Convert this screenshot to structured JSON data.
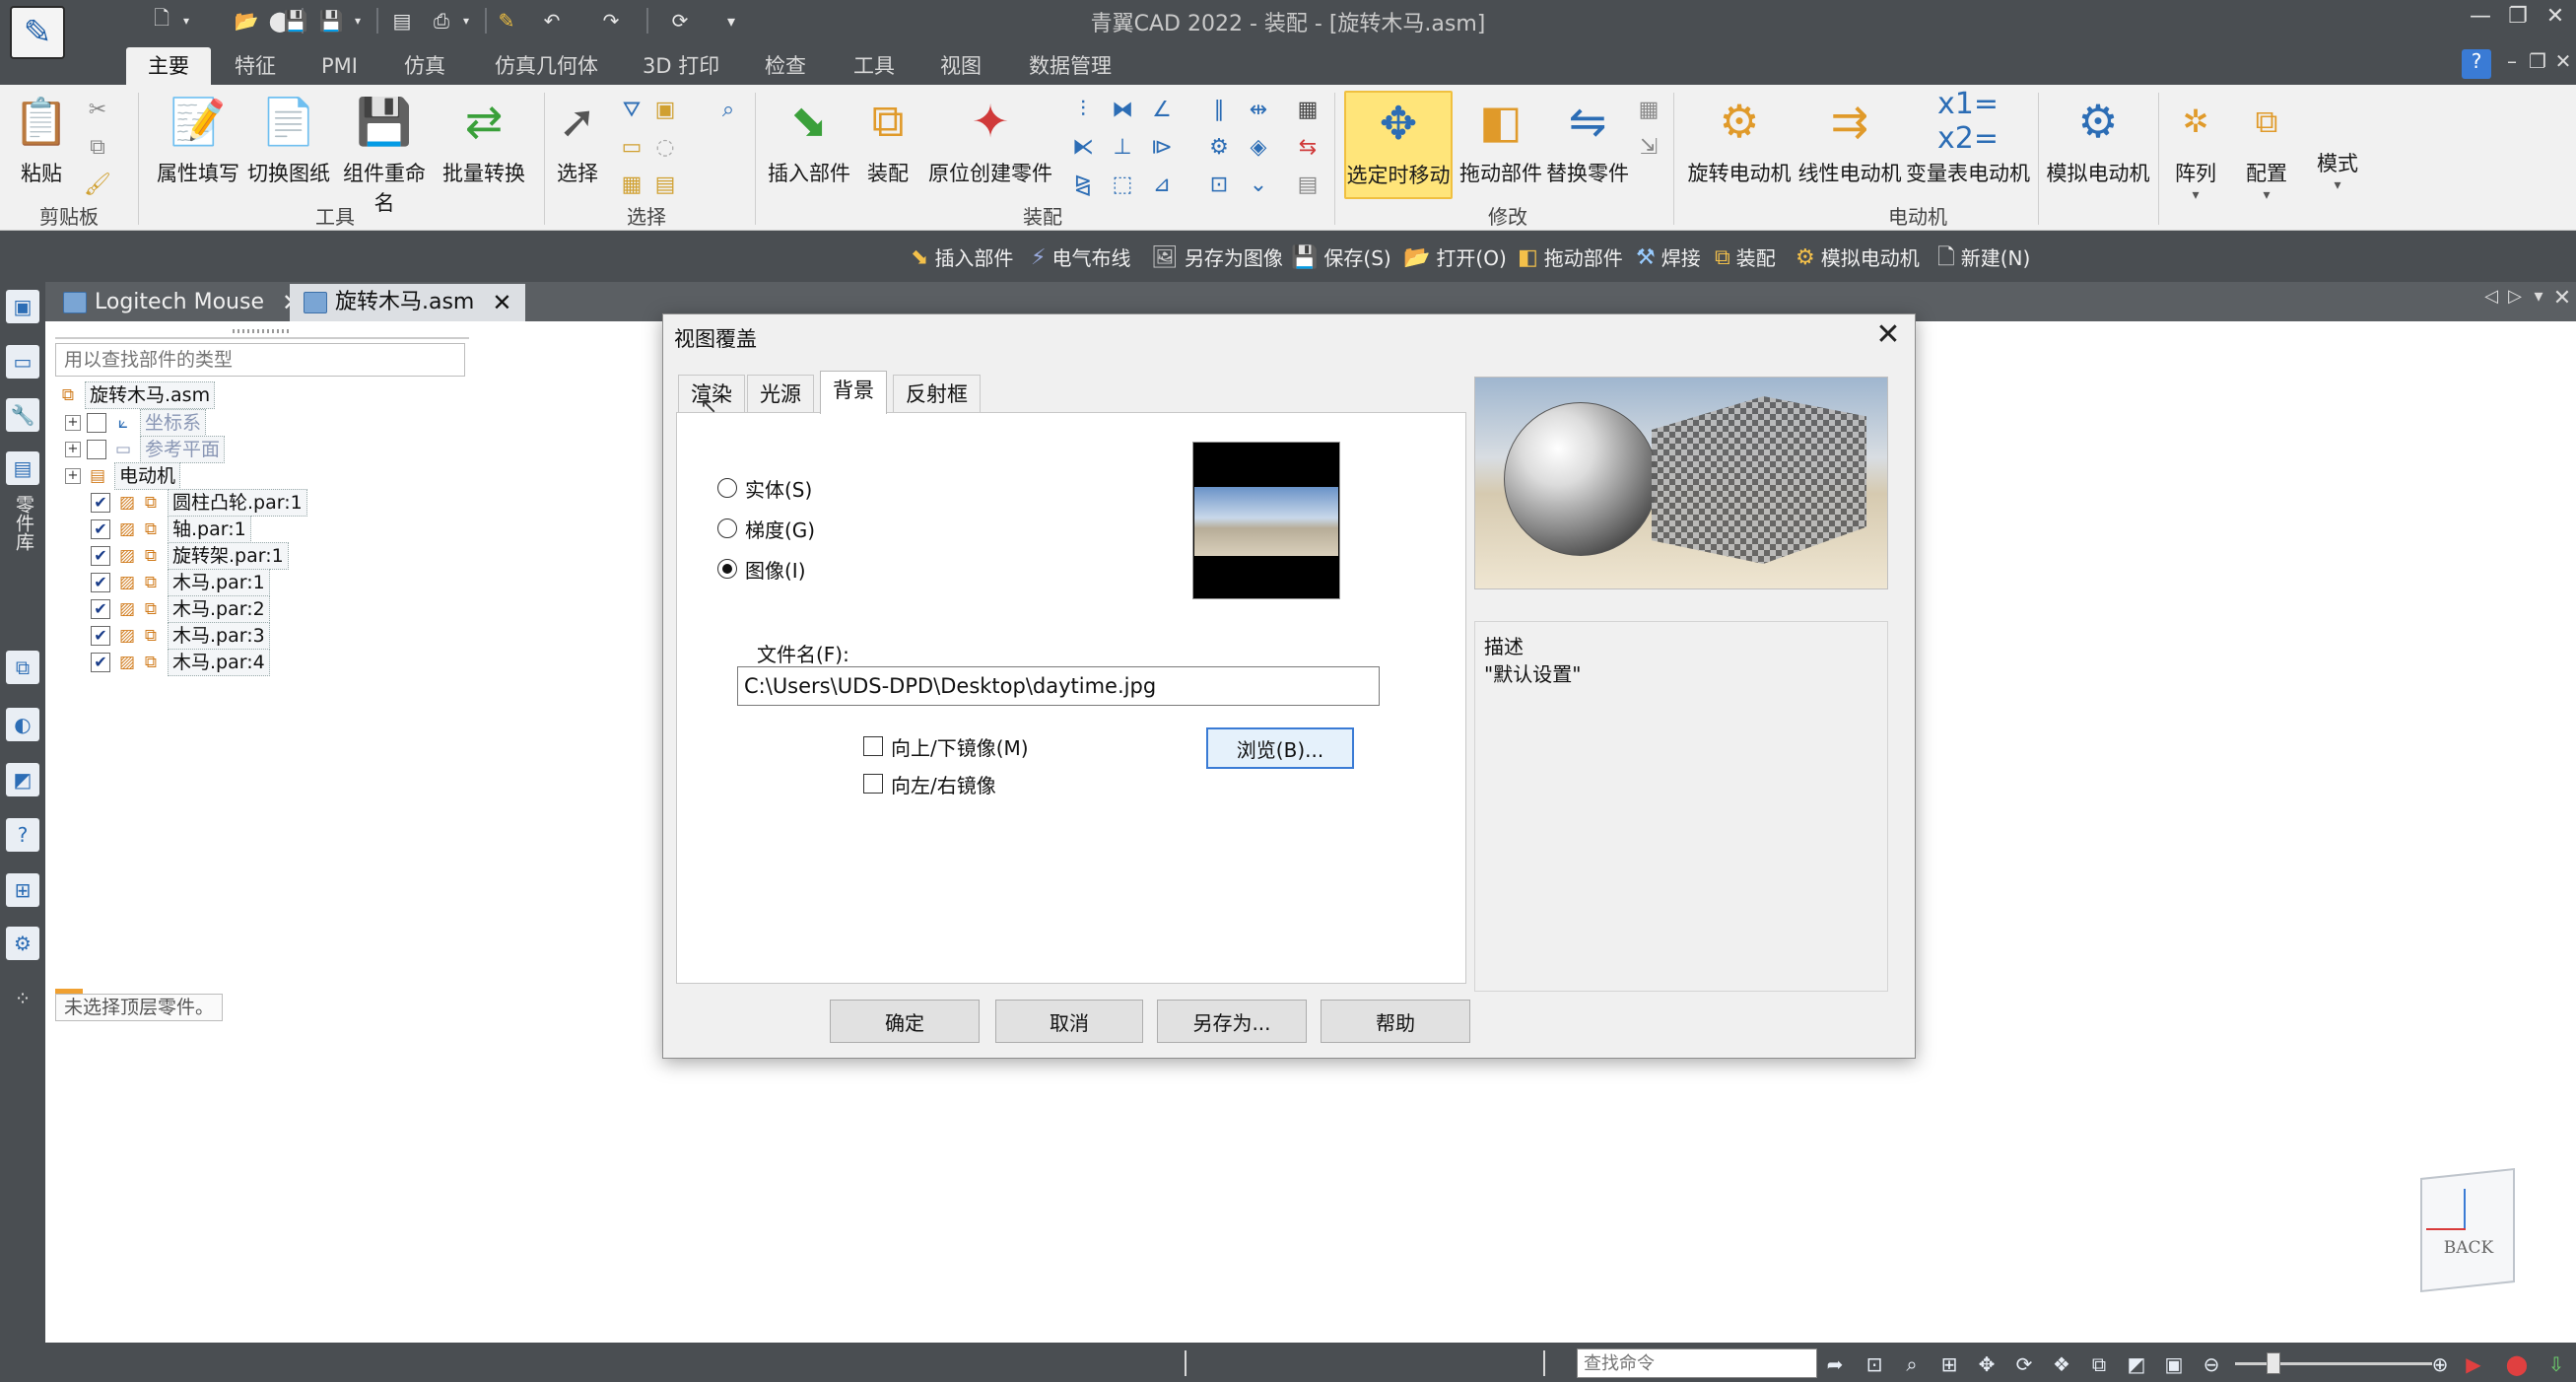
{
  "window": {
    "title": "青翼CAD 2022 - 装配 - [旋转木马.asm]"
  },
  "colors": {
    "chrome": "#4a4e52",
    "ribbon": "#f1f1f1",
    "highlight": "#ffe57a",
    "accent": "#3a7bd5"
  },
  "ribbon_tabs": [
    "主要",
    "特征",
    "PMI",
    "仿真",
    "仿真几何体",
    "3D 打印",
    "检查",
    "工具",
    "视图",
    "数据管理"
  ],
  "ribbon": {
    "paste": "粘贴",
    "clipboard_group": "剪贴板",
    "attr_fill": "属性填写",
    "switch_drawing": "切换图纸",
    "rename_component": "组件重命名",
    "batch_convert": "批量转换",
    "tools_group": "工具",
    "select": "选择",
    "select_group": "选择",
    "insert_part": "插入部件",
    "assemble": "装配",
    "create_in_place": "原位创建零件",
    "assembly_group": "装配",
    "move_on_select": "选定时移动",
    "drag_part": "拖动部件",
    "replace_part": "替换零件",
    "modify_group": "修改",
    "rotary_motor": "旋转电动机",
    "linear_motor": "线性电动机",
    "variable_motor": "变量表电动机",
    "motor_group": "电动机",
    "sim_motor": "模拟电动机",
    "array": "阵列",
    "config": "配置",
    "mode": "模式"
  },
  "cmdbar": [
    "插入部件",
    "电气布线",
    "另存为图像",
    "保存(S)",
    "打开(O)",
    "拖动部件",
    "焊接",
    "装配",
    "模拟电动机",
    "新建(N)"
  ],
  "rail": {
    "label": "零件库"
  },
  "doc_tabs": [
    {
      "label": "Logitech Mouse"
    },
    {
      "label": "旋转木马.asm"
    }
  ],
  "tree": {
    "search_placeholder": "用以查找部件的类型",
    "root": "旋转木马.asm",
    "coord": "坐标系",
    "ref_plane": "参考平面",
    "motor": "电动机",
    "parts": [
      "圆柱凸轮.par:1",
      "轴.par:1",
      "旋转架.par:1",
      "木马.par:1",
      "木马.par:2",
      "木马.par:3",
      "木马.par:4"
    ],
    "status": "未选择顶层零件。"
  },
  "viewcube": {
    "label": "BACK"
  },
  "statusbar": {
    "search_placeholder": "查找命令"
  },
  "dialog": {
    "title": "视图覆盖",
    "tabs": [
      "渲染",
      "光源",
      "背景",
      "反射框"
    ],
    "active_tab": "背景",
    "radio_solid": "实体(S)",
    "radio_gradient": "梯度(G)",
    "radio_image": "图像(I)",
    "file_label": "文件名(F):",
    "file_value": "C:\\Users\\UDS-DPD\\Desktop\\daytime.jpg",
    "mirror_vertical": "向上/下镜像(M)",
    "mirror_horizontal": "向左/右镜像",
    "browse": "浏览(B)...",
    "desc_label": "描述",
    "desc_text": "\"默认设置\"",
    "ok": "确定",
    "cancel": "取消",
    "save_as": "另存为...",
    "help": "帮助"
  }
}
